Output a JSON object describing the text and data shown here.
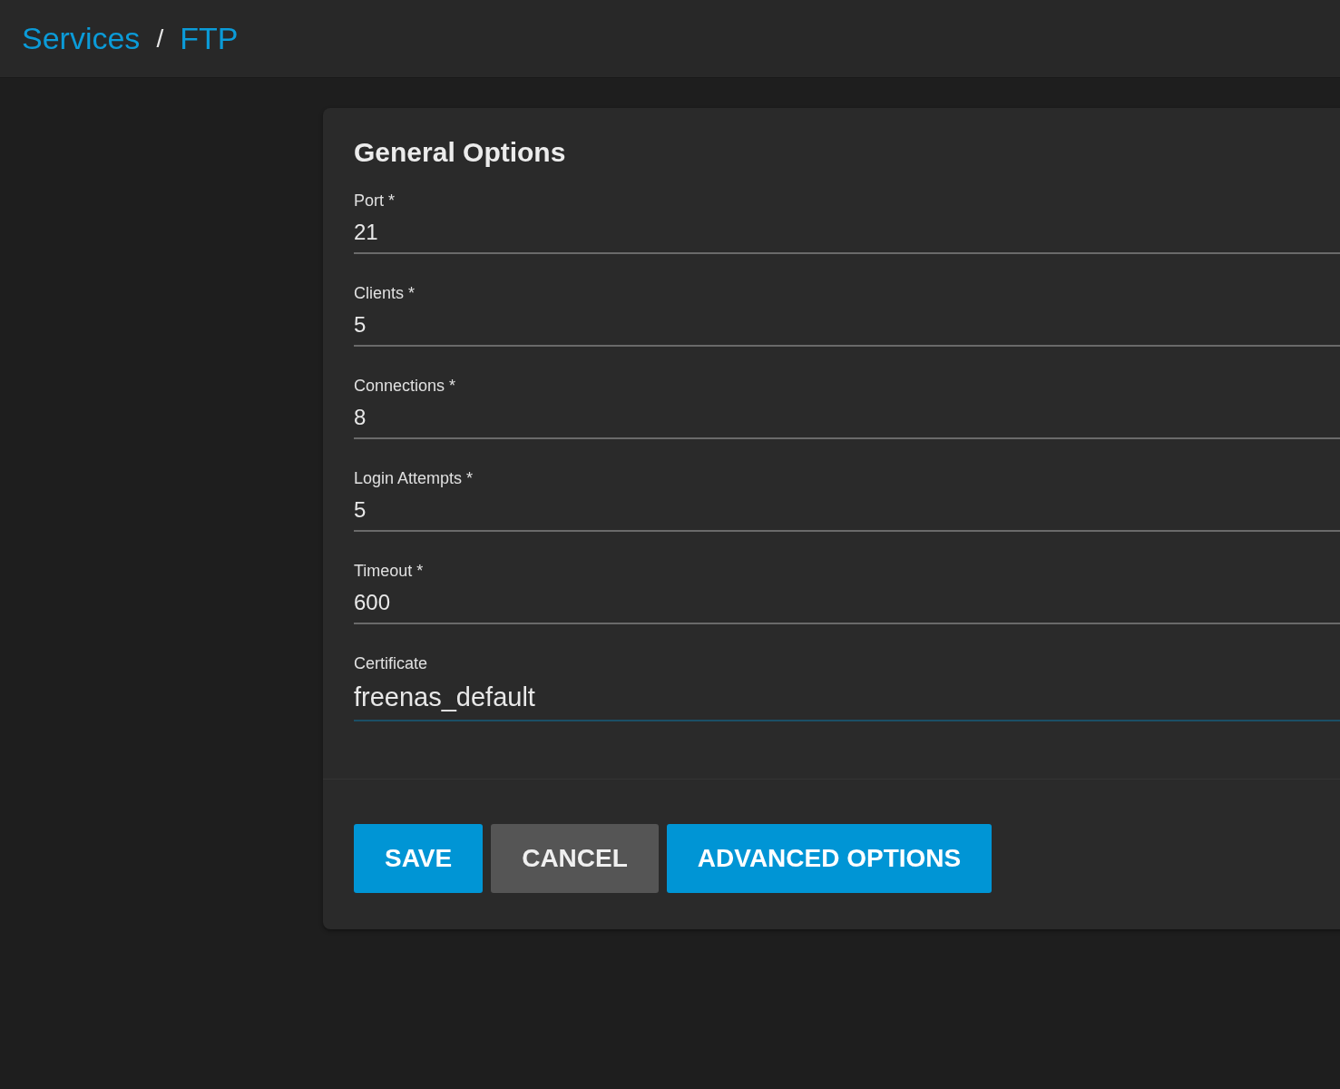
{
  "breadcrumb": [
    {
      "label": "Services"
    },
    {
      "label": "FTP"
    }
  ],
  "breadcrumb_separator": "/",
  "card": {
    "title": "General Options",
    "fields": [
      {
        "label": "Port *",
        "value": "21",
        "focused": false
      },
      {
        "label": "Clients *",
        "value": "5",
        "focused": false
      },
      {
        "label": "Connections *",
        "value": "8",
        "focused": false
      },
      {
        "label": "Login Attempts *",
        "value": "5",
        "focused": false
      },
      {
        "label": "Timeout *",
        "value": "600",
        "focused": false
      },
      {
        "label": "Certificate",
        "value": "freenas_default",
        "focused": true
      }
    ],
    "buttons": [
      {
        "label": "SAVE",
        "kind": "primary"
      },
      {
        "label": "CANCEL",
        "kind": "secondary"
      },
      {
        "label": "ADVANCED OPTIONS",
        "kind": "primary"
      }
    ]
  }
}
